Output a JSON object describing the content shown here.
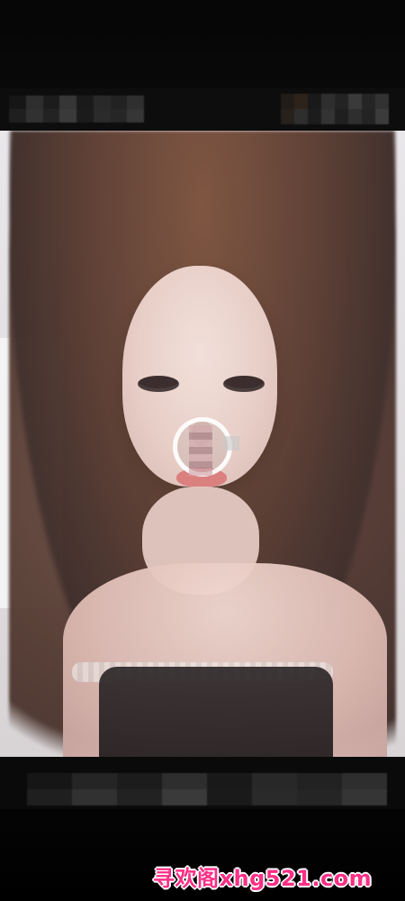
{
  "watermark": {
    "text": "寻欢阁xhg521.com"
  },
  "icons": {
    "center_indicator": "loading-ring-icon"
  }
}
